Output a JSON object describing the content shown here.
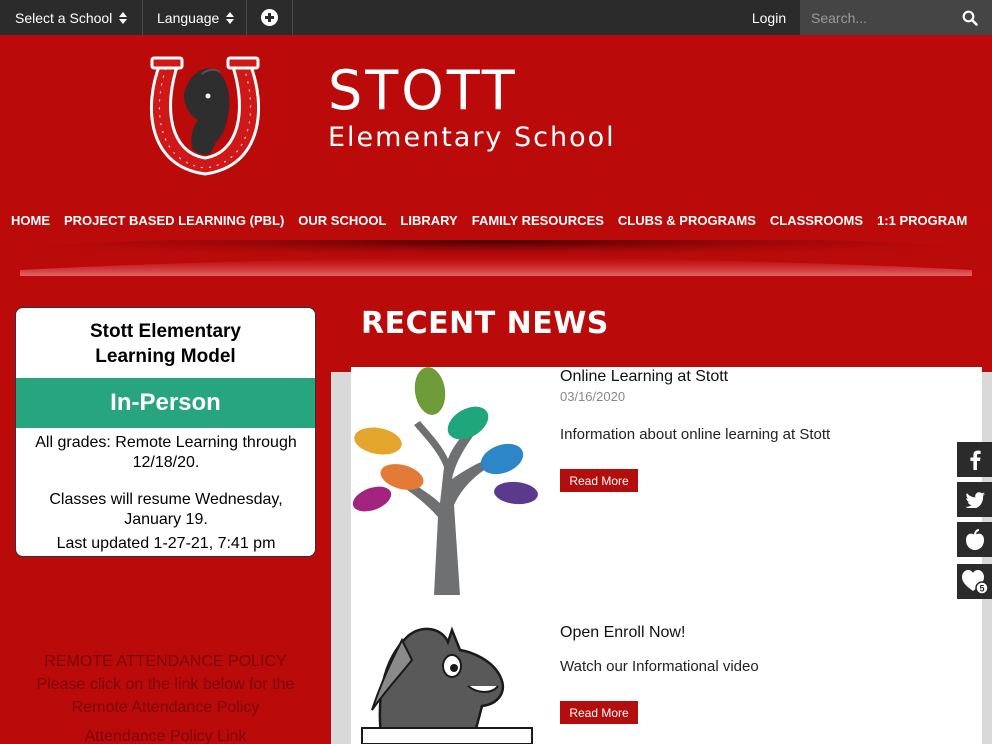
{
  "topbar": {
    "school_select": "Select a School",
    "language_select": "Language",
    "login": "Login",
    "search_placeholder": "Search..."
  },
  "header": {
    "title": "STOTT",
    "subtitle": "Elementary School"
  },
  "nav": [
    "HOME",
    "PROJECT BASED LEARNING (PBL)",
    "OUR SCHOOL",
    "LIBRARY",
    "FAMILY RESOURCES",
    "CLUBS & PROGRAMS",
    "CLASSROOMS",
    "1:1 PROGRAM"
  ],
  "learning_model": {
    "title_line1": "Stott Elementary",
    "title_line2": "Learning Model",
    "status": "In-Person",
    "line1": "All grades: Remote Learning through",
    "line2": "12/18/20.",
    "line3": "Classes will resume Wednesday,",
    "line4": "January 19.",
    "updated": "Last updated 1-27-21, 7:41 pm"
  },
  "attendance": {
    "heading": "REMOTE ATTENDANCE POLICY",
    "line1": "Please click on the link below for the",
    "line2": "Remote Attendance Policy",
    "link": "Attendance Policy Link"
  },
  "news": {
    "heading": "RECENT NEWS",
    "items": [
      {
        "title": "Online Learning at Stott",
        "date": "03/16/2020",
        "description": "Information about online learning at Stott",
        "button": "Read More"
      },
      {
        "title": "Open Enroll Now!",
        "description": "Watch our Informational video",
        "button": "Read More"
      }
    ]
  },
  "social": {
    "badge_count": "5"
  },
  "colors": {
    "brand_red": "#bb0a0a",
    "topbar": "#2b2b2b",
    "in_person_green": "#27a57e",
    "button_red": "#b40d0d"
  },
  "icons": [
    "sort-icon",
    "plus-circle-icon",
    "search-icon",
    "facebook-icon",
    "twitter-icon",
    "apple-icon",
    "heart-icon"
  ]
}
